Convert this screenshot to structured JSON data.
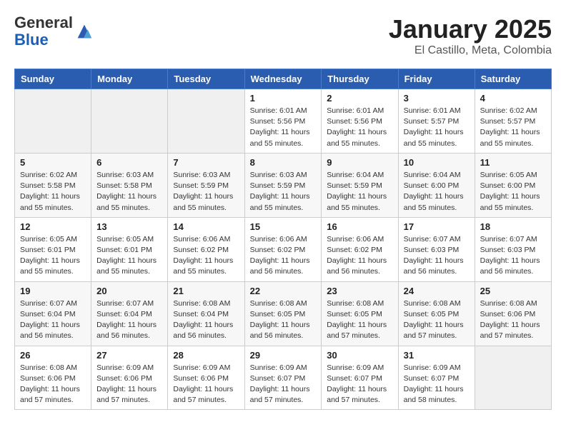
{
  "header": {
    "logo_general": "General",
    "logo_blue": "Blue",
    "month_title": "January 2025",
    "location": "El Castillo, Meta, Colombia"
  },
  "weekdays": [
    "Sunday",
    "Monday",
    "Tuesday",
    "Wednesday",
    "Thursday",
    "Friday",
    "Saturday"
  ],
  "weeks": [
    [
      {
        "day": "",
        "sunrise": "",
        "sunset": "",
        "daylight": ""
      },
      {
        "day": "",
        "sunrise": "",
        "sunset": "",
        "daylight": ""
      },
      {
        "day": "",
        "sunrise": "",
        "sunset": "",
        "daylight": ""
      },
      {
        "day": "1",
        "sunrise": "6:01 AM",
        "sunset": "5:56 PM",
        "daylight": "11 hours and 55 minutes."
      },
      {
        "day": "2",
        "sunrise": "6:01 AM",
        "sunset": "5:56 PM",
        "daylight": "11 hours and 55 minutes."
      },
      {
        "day": "3",
        "sunrise": "6:01 AM",
        "sunset": "5:57 PM",
        "daylight": "11 hours and 55 minutes."
      },
      {
        "day": "4",
        "sunrise": "6:02 AM",
        "sunset": "5:57 PM",
        "daylight": "11 hours and 55 minutes."
      }
    ],
    [
      {
        "day": "5",
        "sunrise": "6:02 AM",
        "sunset": "5:58 PM",
        "daylight": "11 hours and 55 minutes."
      },
      {
        "day": "6",
        "sunrise": "6:03 AM",
        "sunset": "5:58 PM",
        "daylight": "11 hours and 55 minutes."
      },
      {
        "day": "7",
        "sunrise": "6:03 AM",
        "sunset": "5:59 PM",
        "daylight": "11 hours and 55 minutes."
      },
      {
        "day": "8",
        "sunrise": "6:03 AM",
        "sunset": "5:59 PM",
        "daylight": "11 hours and 55 minutes."
      },
      {
        "day": "9",
        "sunrise": "6:04 AM",
        "sunset": "5:59 PM",
        "daylight": "11 hours and 55 minutes."
      },
      {
        "day": "10",
        "sunrise": "6:04 AM",
        "sunset": "6:00 PM",
        "daylight": "11 hours and 55 minutes."
      },
      {
        "day": "11",
        "sunrise": "6:05 AM",
        "sunset": "6:00 PM",
        "daylight": "11 hours and 55 minutes."
      }
    ],
    [
      {
        "day": "12",
        "sunrise": "6:05 AM",
        "sunset": "6:01 PM",
        "daylight": "11 hours and 55 minutes."
      },
      {
        "day": "13",
        "sunrise": "6:05 AM",
        "sunset": "6:01 PM",
        "daylight": "11 hours and 55 minutes."
      },
      {
        "day": "14",
        "sunrise": "6:06 AM",
        "sunset": "6:02 PM",
        "daylight": "11 hours and 55 minutes."
      },
      {
        "day": "15",
        "sunrise": "6:06 AM",
        "sunset": "6:02 PM",
        "daylight": "11 hours and 56 minutes."
      },
      {
        "day": "16",
        "sunrise": "6:06 AM",
        "sunset": "6:02 PM",
        "daylight": "11 hours and 56 minutes."
      },
      {
        "day": "17",
        "sunrise": "6:07 AM",
        "sunset": "6:03 PM",
        "daylight": "11 hours and 56 minutes."
      },
      {
        "day": "18",
        "sunrise": "6:07 AM",
        "sunset": "6:03 PM",
        "daylight": "11 hours and 56 minutes."
      }
    ],
    [
      {
        "day": "19",
        "sunrise": "6:07 AM",
        "sunset": "6:04 PM",
        "daylight": "11 hours and 56 minutes."
      },
      {
        "day": "20",
        "sunrise": "6:07 AM",
        "sunset": "6:04 PM",
        "daylight": "11 hours and 56 minutes."
      },
      {
        "day": "21",
        "sunrise": "6:08 AM",
        "sunset": "6:04 PM",
        "daylight": "11 hours and 56 minutes."
      },
      {
        "day": "22",
        "sunrise": "6:08 AM",
        "sunset": "6:05 PM",
        "daylight": "11 hours and 56 minutes."
      },
      {
        "day": "23",
        "sunrise": "6:08 AM",
        "sunset": "6:05 PM",
        "daylight": "11 hours and 57 minutes."
      },
      {
        "day": "24",
        "sunrise": "6:08 AM",
        "sunset": "6:05 PM",
        "daylight": "11 hours and 57 minutes."
      },
      {
        "day": "25",
        "sunrise": "6:08 AM",
        "sunset": "6:06 PM",
        "daylight": "11 hours and 57 minutes."
      }
    ],
    [
      {
        "day": "26",
        "sunrise": "6:08 AM",
        "sunset": "6:06 PM",
        "daylight": "11 hours and 57 minutes."
      },
      {
        "day": "27",
        "sunrise": "6:09 AM",
        "sunset": "6:06 PM",
        "daylight": "11 hours and 57 minutes."
      },
      {
        "day": "28",
        "sunrise": "6:09 AM",
        "sunset": "6:06 PM",
        "daylight": "11 hours and 57 minutes."
      },
      {
        "day": "29",
        "sunrise": "6:09 AM",
        "sunset": "6:07 PM",
        "daylight": "11 hours and 57 minutes."
      },
      {
        "day": "30",
        "sunrise": "6:09 AM",
        "sunset": "6:07 PM",
        "daylight": "11 hours and 57 minutes."
      },
      {
        "day": "31",
        "sunrise": "6:09 AM",
        "sunset": "6:07 PM",
        "daylight": "11 hours and 58 minutes."
      },
      {
        "day": "",
        "sunrise": "",
        "sunset": "",
        "daylight": ""
      }
    ]
  ]
}
